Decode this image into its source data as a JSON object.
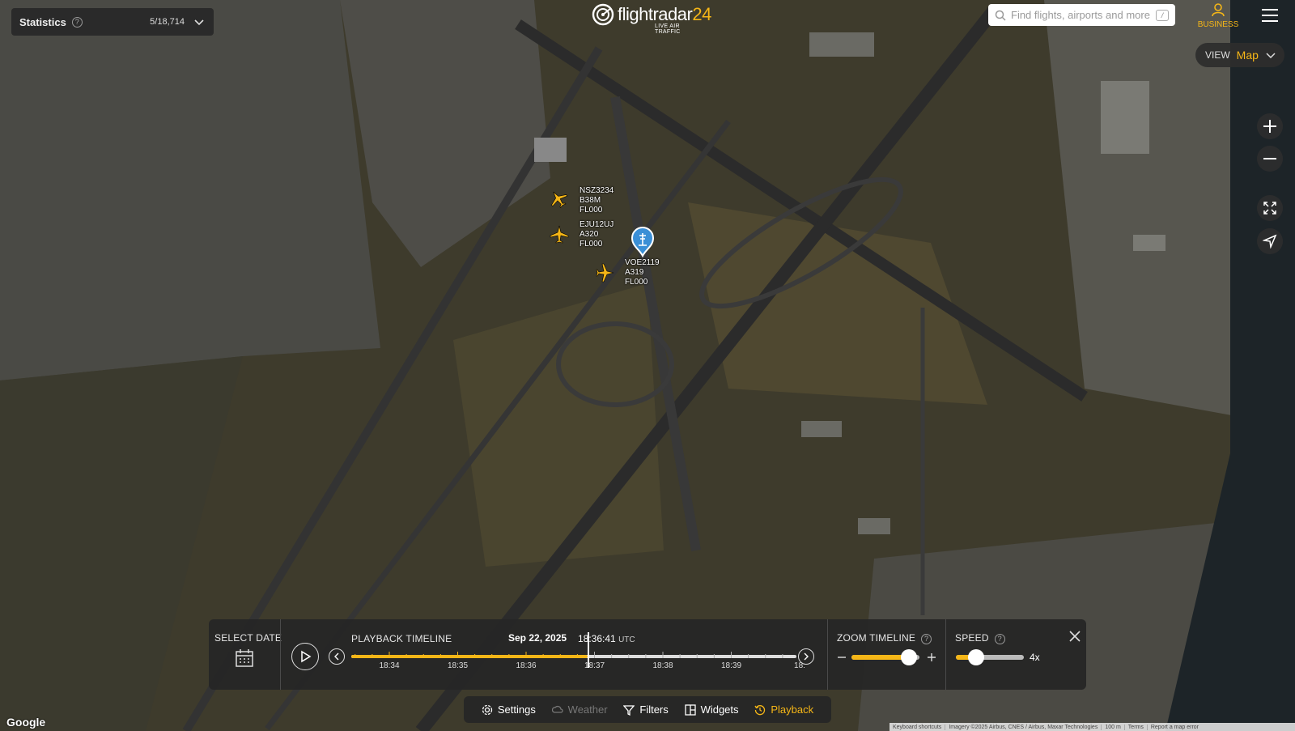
{
  "app": {
    "name": "flightradar24",
    "logo_main": "flightradar",
    "logo_num": "24",
    "logo_sub": "LIVE AIR TRAFFIC",
    "accent": "#f5b617"
  },
  "stats": {
    "title": "Statistics",
    "count": "5/18,714"
  },
  "search": {
    "placeholder": "Find flights, airports and more",
    "shortcut": "/"
  },
  "business": {
    "label": "BUSINESS"
  },
  "view": {
    "label": "VIEW",
    "value": "Map"
  },
  "aircraft": [
    {
      "callsign": "NSZ3234",
      "type": "B38M",
      "level": "FL000"
    },
    {
      "callsign": "EJU12UJ",
      "type": "A320",
      "level": "FL000"
    },
    {
      "callsign": "VOE2119",
      "type": "A319",
      "level": "FL000"
    }
  ],
  "playback": {
    "select_date": "SELECT DATE",
    "timeline_title": "PLAYBACK TIMELINE",
    "date": "Sep 22, 2025",
    "time": "18:36:41",
    "tz": "UTC",
    "progress": 0.53,
    "ticks": [
      "18:34",
      "18:35",
      "18:36",
      "18:37",
      "18:38",
      "18:39",
      "18:"
    ],
    "zoom_title": "ZOOM TIMELINE",
    "zoom_level": 0.85,
    "speed_title": "SPEED",
    "speed_level": 0.3,
    "speed_value": "4x"
  },
  "nav": {
    "settings": "Settings",
    "weather": "Weather",
    "filters": "Filters",
    "widgets": "Widgets",
    "playback": "Playback"
  },
  "footer": {
    "google": "Google",
    "shortcuts": "Keyboard shortcuts",
    "imagery": "Imagery ©2025 Airbus, CNES / Airbus, Maxar Technologies",
    "scale": "100 m",
    "terms": "Terms",
    "report": "Report a map error"
  }
}
